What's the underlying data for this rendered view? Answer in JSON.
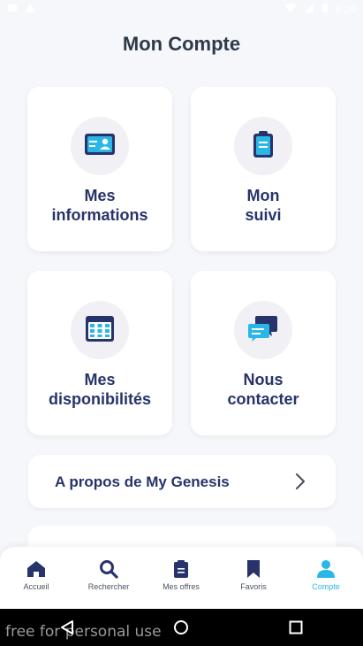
{
  "status_bar": {
    "time": "6:29"
  },
  "page": {
    "title": "Mon Compte"
  },
  "cards": [
    {
      "line1": "Mes",
      "line2": "informations",
      "icon": "id-card-icon"
    },
    {
      "line1": "Mon",
      "line2": "suivi",
      "icon": "clipboard-icon"
    },
    {
      "line1": "Mes",
      "line2": "disponibilités",
      "icon": "calendar-icon"
    },
    {
      "line1": "Nous",
      "line2": "contacter",
      "icon": "chat-icon"
    }
  ],
  "about": {
    "label": "A propos de My Genesis"
  },
  "bottom_nav": {
    "items": [
      {
        "label": "Accueil",
        "icon": "home-icon"
      },
      {
        "label": "Rechercher",
        "icon": "search-icon"
      },
      {
        "label": "Mes offres",
        "icon": "clipboard-icon"
      },
      {
        "label": "Favoris",
        "icon": "bookmark-icon"
      },
      {
        "label": "Compte",
        "icon": "user-icon"
      }
    ],
    "active_index": 4
  },
  "colors": {
    "primary": "#27336a",
    "accent": "#2ab7e8",
    "background": "#f6f7fb"
  },
  "watermark": "free for personal use"
}
